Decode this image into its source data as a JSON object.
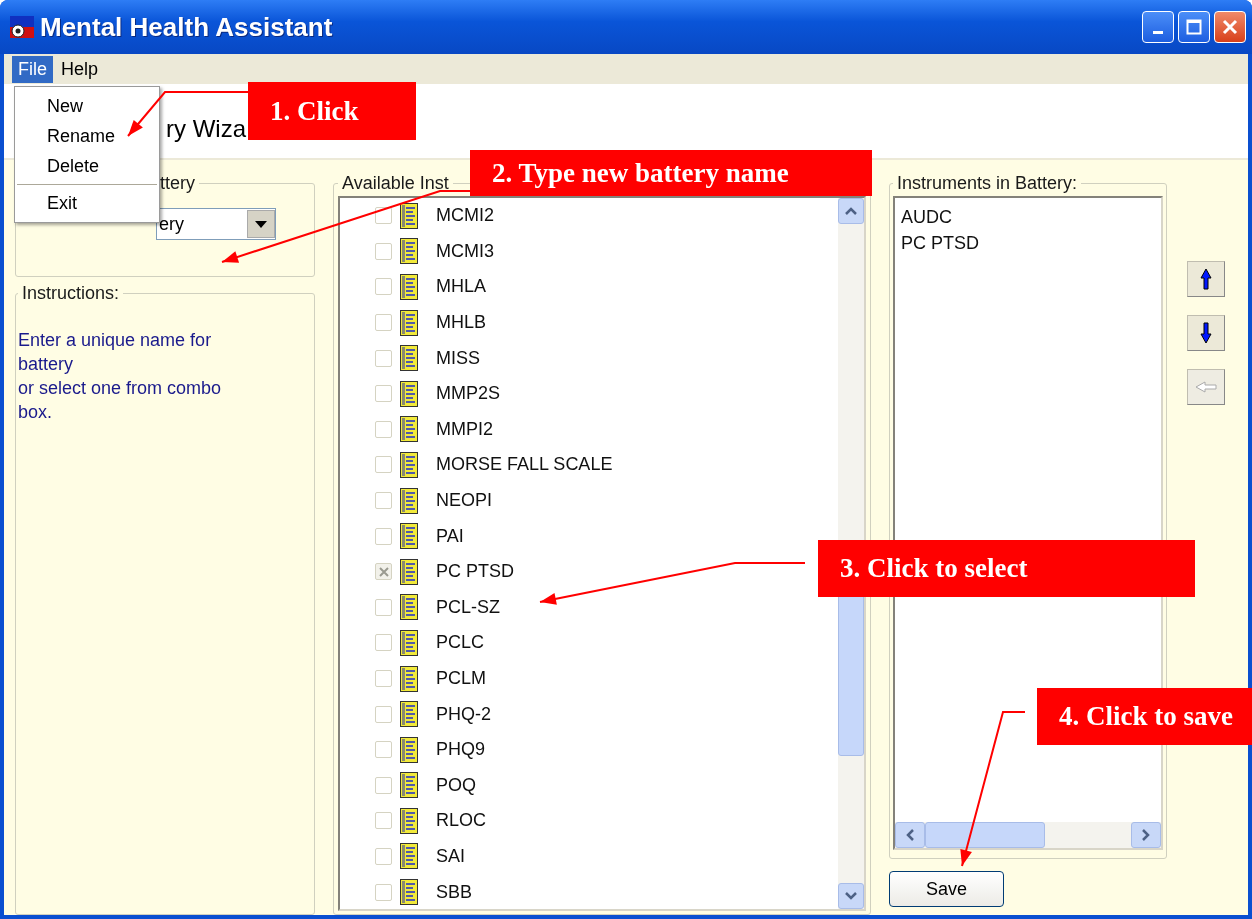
{
  "window": {
    "title": "Mental Health Assistant"
  },
  "menu_bar": [
    {
      "label": "File",
      "selected": true
    },
    {
      "label": "Help",
      "selected": false
    }
  ],
  "file_menu": [
    {
      "kind": "item",
      "label": "New"
    },
    {
      "kind": "item",
      "label": "Rename"
    },
    {
      "kind": "item",
      "label": "Delete"
    },
    {
      "kind": "separator"
    },
    {
      "kind": "item",
      "label": "Exit"
    }
  ],
  "header": {
    "title": "ry Wiza"
  },
  "battery_group": {
    "label": "ttery",
    "combo_value": "ery"
  },
  "instructions": {
    "label": "Instructions:",
    "text": "Enter a unique name for battery\nor select one from combo box."
  },
  "available": {
    "label": "Available Inst",
    "items": [
      {
        "label": "MCMI2",
        "checked": false
      },
      {
        "label": "MCMI3",
        "checked": false
      },
      {
        "label": "MHLA",
        "checked": false
      },
      {
        "label": "MHLB",
        "checked": false
      },
      {
        "label": "MISS",
        "checked": false
      },
      {
        "label": "MMP2S",
        "checked": false
      },
      {
        "label": "MMPI2",
        "checked": false
      },
      {
        "label": "MORSE FALL SCALE",
        "checked": false
      },
      {
        "label": "NEOPI",
        "checked": false
      },
      {
        "label": "PAI",
        "checked": false
      },
      {
        "label": "PC PTSD",
        "checked": true
      },
      {
        "label": "PCL-SZ",
        "checked": false
      },
      {
        "label": "PCLC",
        "checked": false
      },
      {
        "label": "PCLM",
        "checked": false
      },
      {
        "label": "PHQ-2",
        "checked": false
      },
      {
        "label": "PHQ9",
        "checked": false
      },
      {
        "label": "POQ",
        "checked": false
      },
      {
        "label": "RLOC",
        "checked": false
      },
      {
        "label": "SAI",
        "checked": false
      },
      {
        "label": "SBB",
        "checked": false
      }
    ]
  },
  "battery_list": {
    "label": "Instruments in Battery:",
    "items": [
      "AUDC",
      "PC PTSD"
    ]
  },
  "side_buttons": [
    {
      "kind": "up",
      "disabled": false
    },
    {
      "kind": "down",
      "disabled": false
    },
    {
      "kind": "left",
      "disabled": true
    }
  ],
  "save_button": {
    "label": "Save"
  },
  "callouts": [
    {
      "text": "1. Click"
    },
    {
      "text": "2. Type new battery name"
    },
    {
      "text": "3. Click to select"
    },
    {
      "text": "4. Click to save"
    }
  ]
}
